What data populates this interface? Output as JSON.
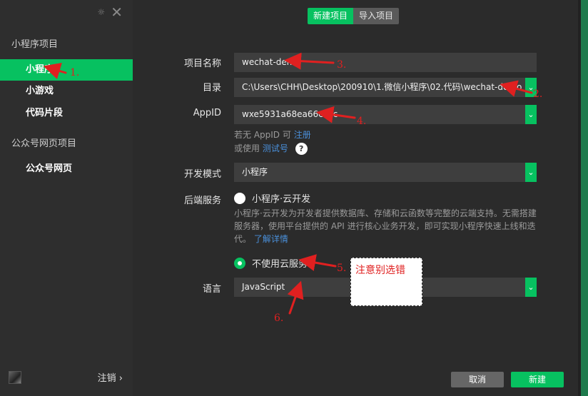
{
  "sidebar": {
    "section_miniapp": "小程序项目",
    "items": [
      {
        "label": "小程序",
        "active": true
      },
      {
        "label": "小游戏",
        "active": false
      },
      {
        "label": "代码片段",
        "active": false
      }
    ],
    "section_official": "公众号网页项目",
    "official_item": "公众号网页",
    "logout": "注销 ›"
  },
  "tabs": {
    "new_project": "新建项目",
    "import_project": "导入项目"
  },
  "form": {
    "project_name_label": "项目名称",
    "project_name_value": "wechat-demo",
    "directory_label": "目录",
    "directory_value": "C:\\Users\\CHH\\Desktop\\200910\\1.微信小程序\\02.代码\\wechat-demo",
    "appid_label": "AppID",
    "appid_value": "wxe5931a68ea66cecc",
    "appid_hint_prefix": "若无 AppID 可",
    "appid_hint_link": "注册",
    "test_hint_prefix": "或使用",
    "test_hint_link": "测试号",
    "help_icon": "?",
    "dev_mode_label": "开发模式",
    "dev_mode_value": "小程序",
    "backend_label": "后端服务",
    "cloud_option": "小程序·云开发",
    "cloud_desc": "小程序·云开发为开发者提供数据库、存储和云函数等完整的云端支持。无需搭建服务器，使用平台提供的 API 进行核心业务开发，即可实现小程序快速上线和迭代。",
    "cloud_desc_link": "了解详情",
    "no_cloud_option": "不使用云服务",
    "language_label": "语言",
    "language_value": "JavaScript"
  },
  "buttons": {
    "cancel": "取消",
    "create": "新建"
  },
  "annotations": {
    "note": "注意别选错",
    "n1": "1.",
    "n2": "2.",
    "n3": "3.",
    "n4": "4.",
    "n5": "5.",
    "n6": "6."
  },
  "colors": {
    "accent": "#07c160",
    "annotation": "#e02020",
    "link": "#4a8fd9"
  }
}
